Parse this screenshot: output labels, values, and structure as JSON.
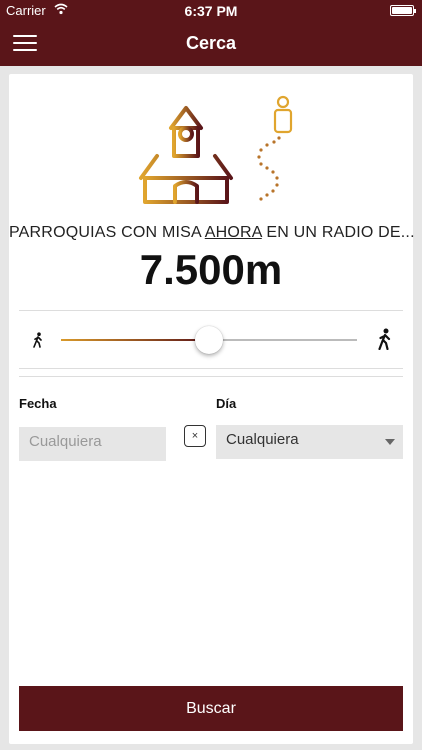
{
  "status_bar": {
    "carrier": "Carrier",
    "time": "6:37 PM"
  },
  "nav": {
    "title": "Cerca",
    "menu_icon": "hamburger-menu-icon"
  },
  "hero": {
    "headline_before": "PARROQUIAS CON MISA ",
    "headline_emphasis": "AHORA",
    "headline_after": " EN UN RADIO DE...",
    "distance": "7.500m",
    "illustration_icons": [
      "church-icon",
      "person-icon",
      "dotted-path-icon"
    ]
  },
  "slider": {
    "level": 0.5,
    "min_icon": "walking-person-small-icon",
    "max_icon": "walking-person-large-icon"
  },
  "filters": {
    "fecha_label": "Fecha",
    "fecha_placeholder": "Cualquiera",
    "clear_label": "×",
    "dia_label": "Día",
    "dia_value": "Cualquiera"
  },
  "actions": {
    "search_label": "Buscar"
  },
  "colors": {
    "primary": "#5a1519",
    "accent_gold": "#d99a2b",
    "field_bg": "#e6e6e6"
  }
}
